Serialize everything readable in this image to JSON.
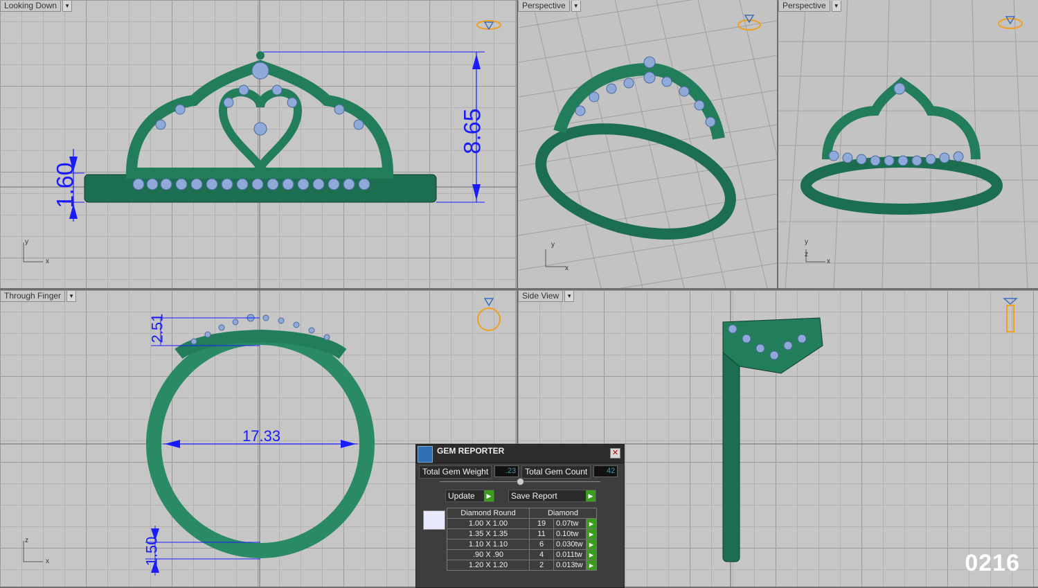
{
  "viewports": {
    "top_left": {
      "label": "Looking Down"
    },
    "top_mid": {
      "label": "Perspective"
    },
    "top_right": {
      "label": "Perspective"
    },
    "bottom_left": {
      "label": "Through Finger"
    },
    "bottom_right": {
      "label": "Side View"
    }
  },
  "axes": {
    "x": "x",
    "y": "y",
    "z": "z"
  },
  "dimensions": {
    "crown_height": "8.65",
    "band_height": "1.60",
    "top_thickness": "2.51",
    "inner_diameter": "17.33",
    "shank_thickness": "1.50"
  },
  "gem_reporter": {
    "title": "GEM REPORTER",
    "total_weight_label": "Total Gem Weight",
    "total_weight_value": ".23",
    "total_count_label": "Total Gem Count",
    "total_count_value": "42",
    "update_label": "Update",
    "save_label": "Save Report",
    "col_shape": "Diamond Round",
    "col_material": "Diamond",
    "rows": [
      {
        "size": "1.00 X 1.00",
        "count": "19",
        "weight": "0.07tw"
      },
      {
        "size": "1.35 X 1.35",
        "count": "11",
        "weight": "0.10tw"
      },
      {
        "size": "1.10 X 1.10",
        "count": "6",
        "weight": "0.030tw"
      },
      {
        "size": ".90 X .90",
        "count": "4",
        "weight": "0.011tw"
      },
      {
        "size": "1.20 X 1.20",
        "count": "2",
        "weight": "0.013tw"
      }
    ]
  },
  "watermark": "0216",
  "colors": {
    "metal": "#1e7a58",
    "gem": "#8fa9d8",
    "dimension": "#1a1aff",
    "viewcube": "#f0a020"
  }
}
